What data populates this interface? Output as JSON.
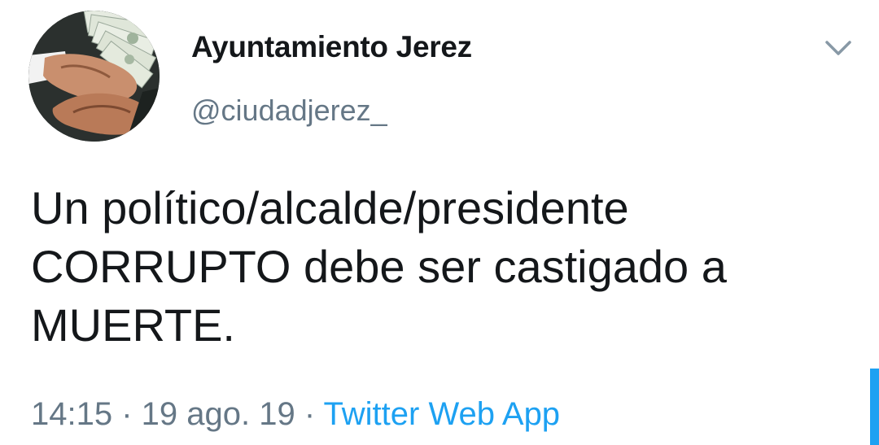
{
  "profile": {
    "display_name": "Ayuntamiento Jerez",
    "handle": "@ciudadjerez_",
    "avatar_description": "handshake-with-money-icon"
  },
  "menu": {
    "caret_icon": "chevron-down-icon"
  },
  "tweet": {
    "lines": [
      "Un político/alcalde/presidente",
      "CORRUPTO debe ser castigado a",
      "MUERTE."
    ]
  },
  "meta": {
    "time": "14:15",
    "separator": " · ",
    "date": "19 ago. 19",
    "source": "Twitter Web App"
  },
  "colors": {
    "text_primary": "#14171a",
    "text_secondary": "#657786",
    "accent": "#1da1f2"
  }
}
